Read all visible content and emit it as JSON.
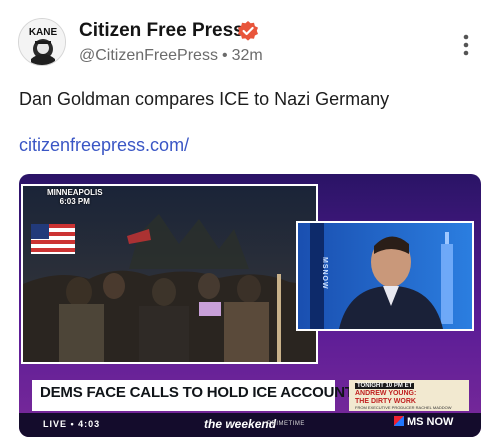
{
  "post": {
    "account_name": "Citizen Free Press",
    "handle": "@CitizenFreePress",
    "separator": "•",
    "timestamp": "32m",
    "text": "Dan Goldman compares ICE to Nazi Germany",
    "link_text": "citizenfreepress.com/"
  },
  "avatar": {
    "logo_text": "KANE"
  },
  "icons": {
    "avatar": "kane-logo-avatar",
    "verified": "verified-badge-icon",
    "more": "more-vertical-icon"
  },
  "colors": {
    "verified_badge": "#e8553b",
    "link": "#3a56c5",
    "secondary_text": "#6b6b6b",
    "media_frame": "#5a1c96"
  },
  "media": {
    "location_city": "MINNEAPOLIS",
    "location_time": "6:03 PM",
    "side_strip_text": "MSNOW",
    "headline": "DEMS FACE CALLS TO HOLD ICE ACCOUNTABLE",
    "promo_tonight": "TONIGHT 10 PM ET",
    "promo_title_line1": "ANDREW YOUNG:",
    "promo_title_line2": "THE DIRTY WORK",
    "promo_sub": "FROM EXECUTIVE PRODUCER RACHEL MADDOW",
    "live_label": "LIVE • 4:03",
    "show_title": "the weekend",
    "show_suffix": "PRIMETIME",
    "network": "MS NOW"
  }
}
